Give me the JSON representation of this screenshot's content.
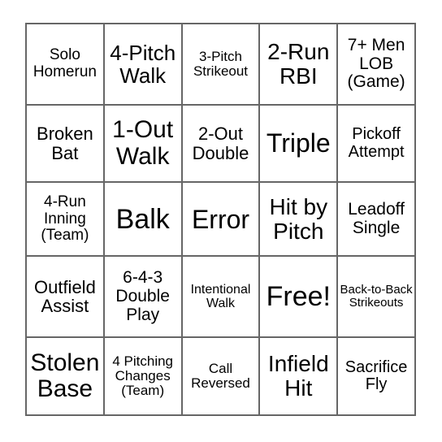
{
  "card": {
    "type": "bingo-card",
    "grid_size": 5,
    "free_space_index": 12,
    "free_space_label": "Free!",
    "background_color": "#ffffff",
    "border_color": "#666666",
    "text_color": "#000000",
    "rows": [
      [
        {
          "text": "Solo Homerun",
          "size": "fs-19"
        },
        {
          "text": "4-Pitch Walk",
          "size": "fs-26"
        },
        {
          "text": "3-Pitch Strikeout",
          "size": "fs-17"
        },
        {
          "text": "2-Run RBI",
          "size": "fs-28"
        },
        {
          "text": "7+ Men LOB (Game)",
          "size": "fs-21"
        }
      ],
      [
        {
          "text": "Broken Bat",
          "size": "fs-22"
        },
        {
          "text": "1-Out Walk",
          "size": "fs-30"
        },
        {
          "text": "2-Out Double",
          "size": "fs-22"
        },
        {
          "text": "Triple",
          "size": "fs-32"
        },
        {
          "text": "Pickoff Attempt",
          "size": "fs-20"
        }
      ],
      [
        {
          "text": "4-Run Inning (Team)",
          "size": "fs-19"
        },
        {
          "text": "Balk",
          "size": "fs-34"
        },
        {
          "text": "Error",
          "size": "fs-32"
        },
        {
          "text": "Hit by Pitch",
          "size": "fs-28"
        },
        {
          "text": "Leadoff Single",
          "size": "fs-21"
        }
      ],
      [
        {
          "text": "Outfield Assist",
          "size": "fs-22"
        },
        {
          "text": "6-4-3 Double Play",
          "size": "fs-21"
        },
        {
          "text": "Intentional Walk",
          "size": "fs-16"
        },
        {
          "text": "Free!",
          "size": "fs-34"
        },
        {
          "text": "Back-to-Back Strikeouts",
          "size": "fs-15"
        }
      ],
      [
        {
          "text": "Stolen Base",
          "size": "fs-30"
        },
        {
          "text": "4 Pitching Changes (Team)",
          "size": "fs-17"
        },
        {
          "text": "Call Reversed",
          "size": "fs-17"
        },
        {
          "text": "Infield Hit",
          "size": "fs-28"
        },
        {
          "text": "Sacrifice Fly",
          "size": "fs-20"
        }
      ]
    ]
  }
}
